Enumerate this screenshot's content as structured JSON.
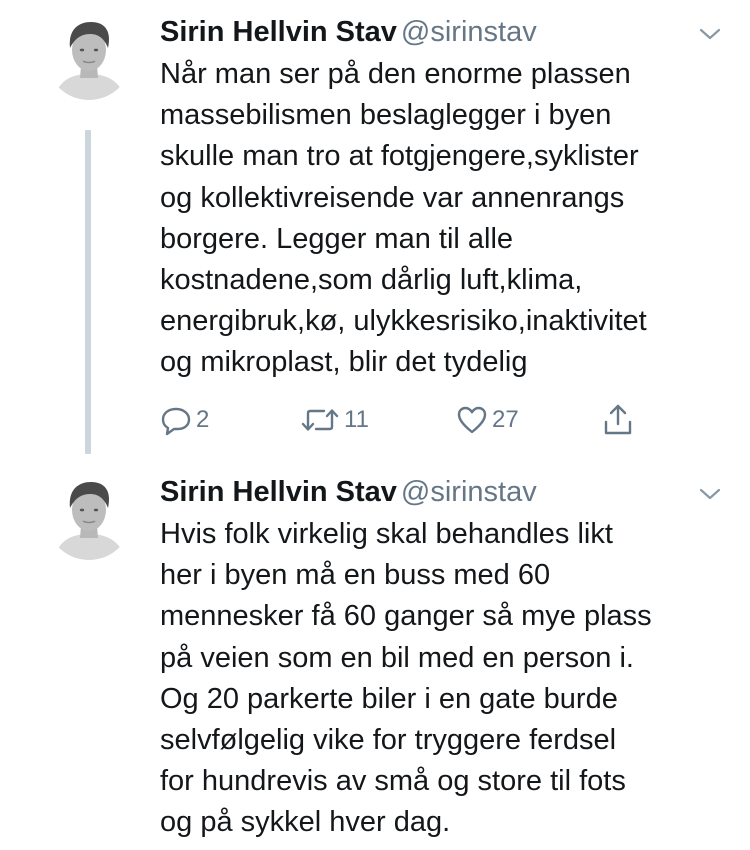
{
  "tweets": [
    {
      "display_name": "Sirin Hellvin Stav",
      "handle": "@sirinstav",
      "text": "Når man ser på den enorme plassen\nmassebilismen beslaglegger i byen\nskulle man tro at fotgjengere,syklister\nog kollektivreisende var annenrangs\nborgere. Legger man til alle\nkostnadene,som dårlig luft,klima,\nenergibruk,kø, ulykkesrisiko,inaktivitet\nog mikroplast, blir det tydelig",
      "replies": "2",
      "retweets": "11",
      "likes": "27",
      "icons": {
        "reply": "reply-icon",
        "retweet": "retweet-icon",
        "like": "heart-icon",
        "share": "share-icon",
        "caret": "chevron-down-icon"
      }
    },
    {
      "display_name": "Sirin Hellvin Stav",
      "handle": "@sirinstav",
      "text": "Hvis folk virkelig skal behandles likt\nher i byen må en buss med 60\nmennesker få 60 ganger så mye plass\npå veien som en bil med en person i.\nOg 20 parkerte biler i en gate burde\nselvfølgelig vike for tryggere ferdsel\nfor hundrevis av små og store til fots\nog på sykkel hver dag."
    }
  ],
  "colors": {
    "text": "#14171a",
    "secondary": "#657786",
    "thread_line": "#ccd6dd",
    "background": "#ffffff"
  }
}
